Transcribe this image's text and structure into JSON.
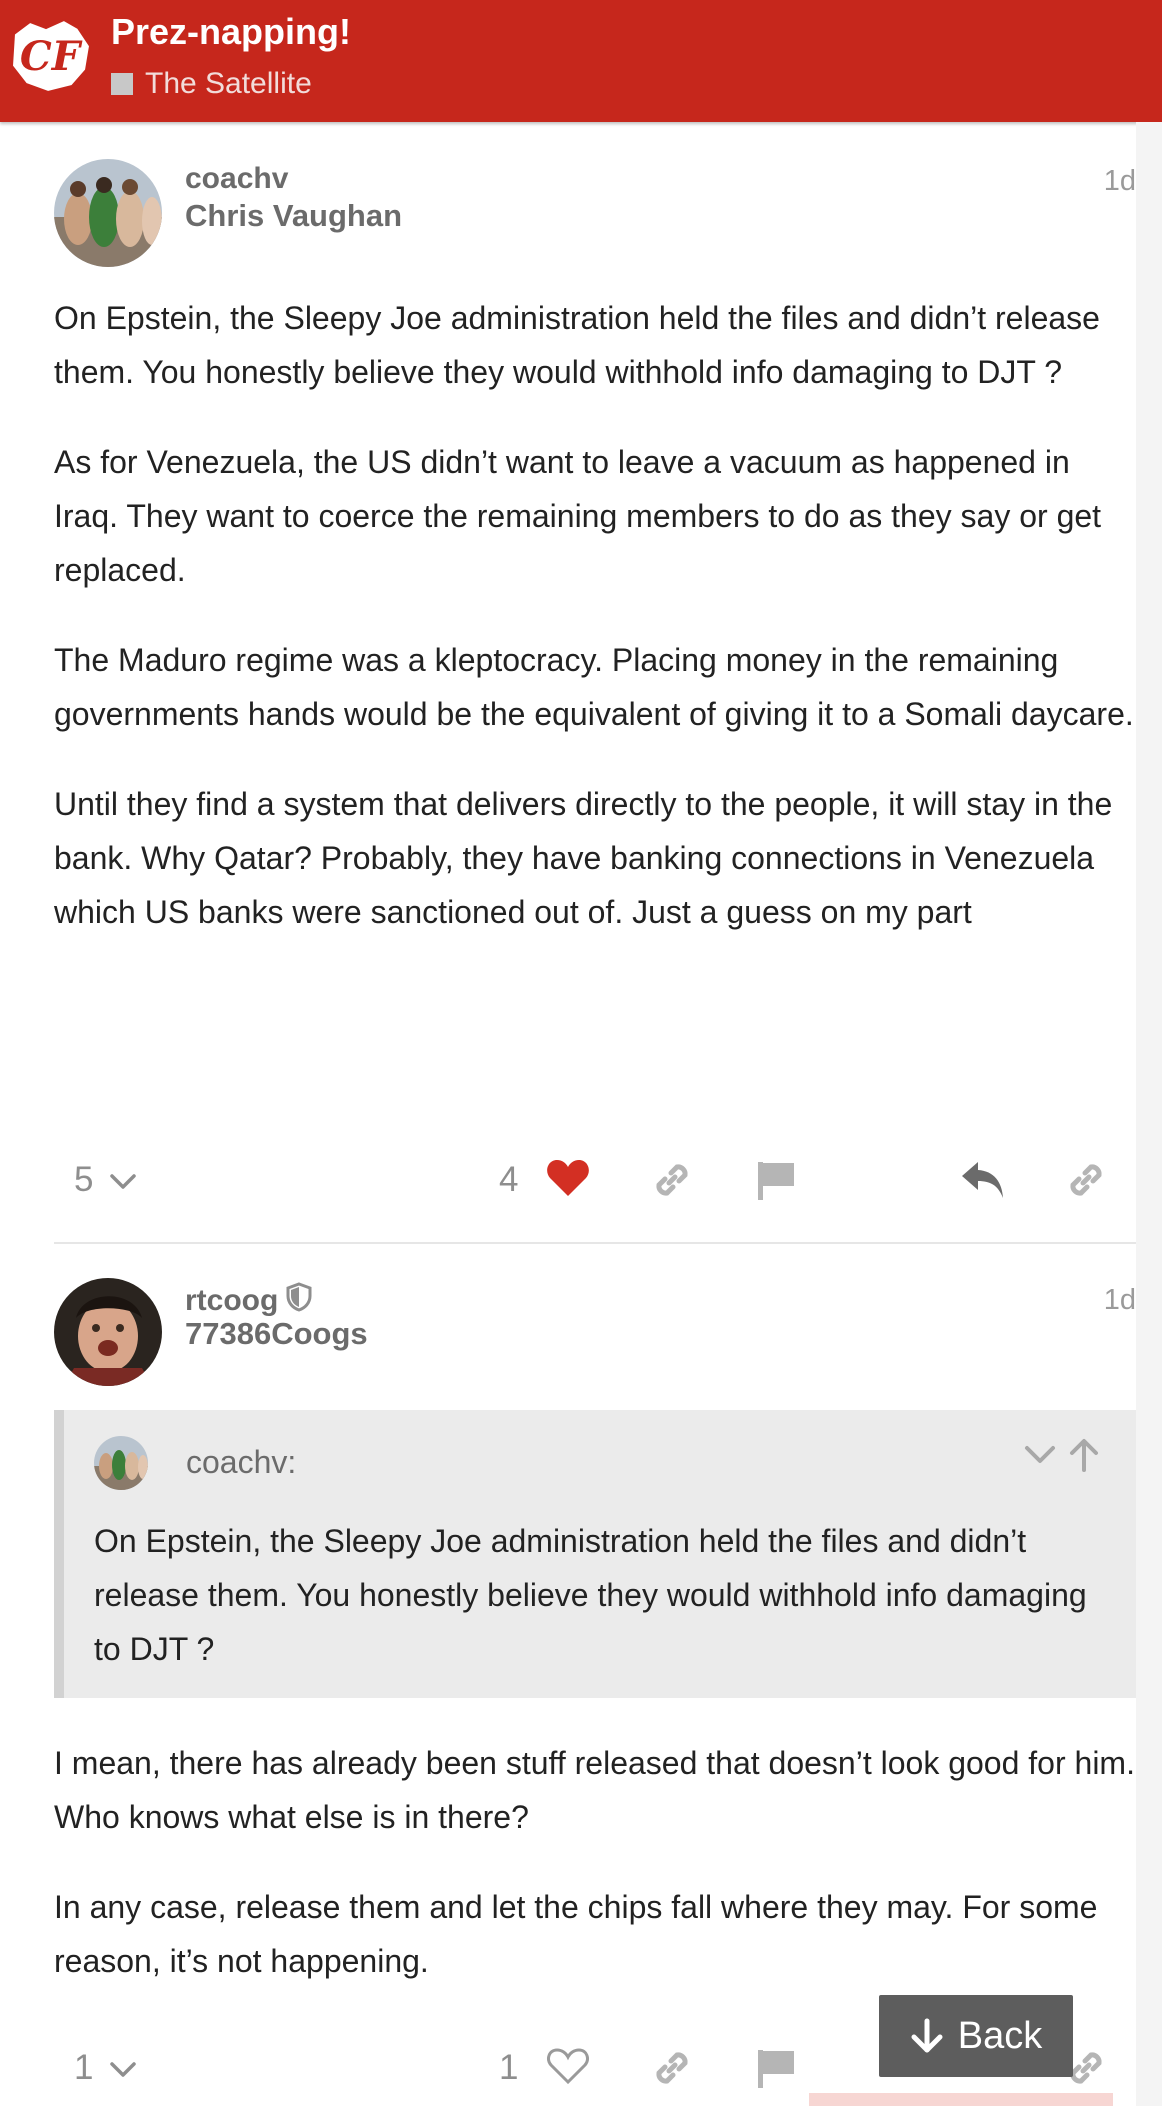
{
  "header": {
    "title": "Prez-napping!",
    "category": "The Satellite",
    "logo_text": "CF"
  },
  "posts": [
    {
      "username": "coachv",
      "full_name": "Chris Vaughan",
      "age": "1d",
      "paragraphs": [
        "On Epstein, the Sleepy Joe administration held the files and didn’t release them. You honestly believe they would withhold info damaging to DJT ?",
        "As for Venezuela, the US didn’t want to leave a vacuum as happened in Iraq. They want to coerce the remaining members to do as they say or get replaced.",
        "The Maduro regime was a kleptocracy. Placing money in the remaining governments hands would be the equivalent of giving it to a Somali daycare.",
        "Until they find a system that delivers directly to the people, it will stay in the bank. Why Qatar? Probably, they have banking connections in Venezuela which US banks were sanctioned out of. Just a guess on my part"
      ],
      "reply_count": "5",
      "like_count": "4",
      "liked": true
    },
    {
      "username": "rtcoog",
      "full_name": "77386Coogs",
      "age": "1d",
      "quote": {
        "user": "coachv:",
        "text": "On Epstein, the Sleepy Joe administration held the files and didn’t release them. You honestly believe they would withhold info damaging to DJT ?"
      },
      "paragraphs": [
        "I mean, there has already been stuff released that doesn’t look good for him. Who knows what else is in there?",
        "In any case, release them and let the chips fall where they may. For some reason, it’s not happening."
      ],
      "reply_count": "1",
      "like_count": "1",
      "liked": false
    }
  ],
  "back_button": {
    "label": "Back"
  },
  "colors": {
    "brand": "#c6271c",
    "like": "#d32f23",
    "muted": "#8e8e8e",
    "quote_bg": "#ebebeb"
  },
  "icons": {
    "header_logo": "cf-logo",
    "like_active": "heart-filled-icon",
    "like_inactive": "heart-outline-icon",
    "link": "link-icon",
    "flag": "flag-icon",
    "reply": "reply-icon",
    "expand": "chevron-down-icon",
    "collapse_up": "arrow-up-icon",
    "moderator": "shield-icon",
    "back": "arrow-down-icon"
  }
}
